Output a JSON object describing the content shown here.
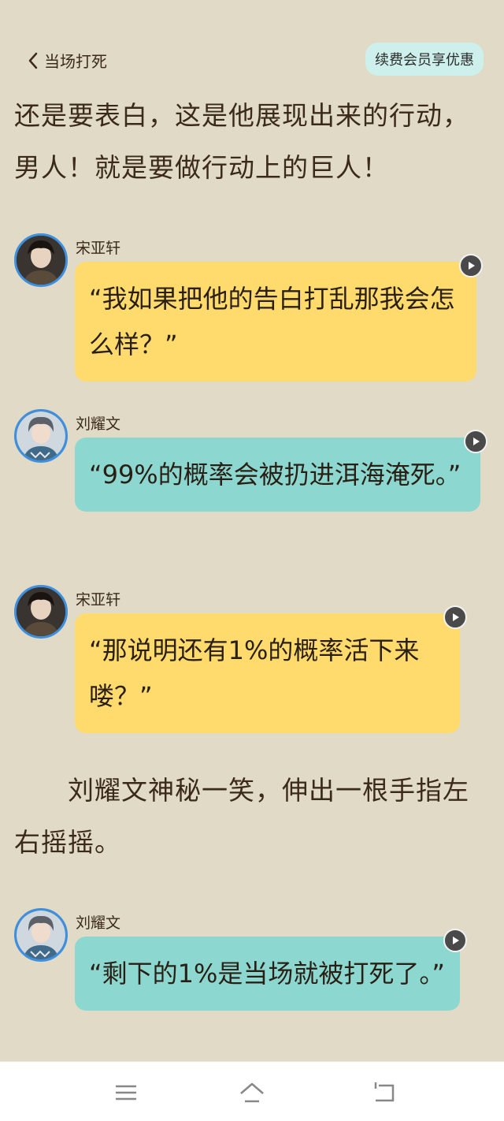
{
  "header": {
    "back_label": "当场打死",
    "vip_label": "续费会员享优惠"
  },
  "narration": {
    "para1": "还是要表白，这是他展现出来的行动，男人！就是要做行动上的巨人！",
    "para2": "　　刘耀文神秘一笑，伸出一根手指左右摇摇。"
  },
  "messages": [
    {
      "speaker": "宋亚轩",
      "text": "“我如果把他的告白打乱那我会怎么样？”",
      "color": "yellow"
    },
    {
      "speaker": "刘耀文",
      "text": "“99%的概率会被扔进洱海淹死。”",
      "color": "teal"
    },
    {
      "speaker": "宋亚轩",
      "text": "“那说明还有1%的概率活下来喽？”",
      "color": "yellow"
    },
    {
      "speaker": "刘耀文",
      "text": "“剩下的1%是当场就被打死了。”",
      "color": "teal"
    }
  ],
  "icons": {
    "back": "chevron-left-icon",
    "play": "play-icon",
    "nav_menu": "menu-icon",
    "nav_home": "home-icon",
    "nav_back": "back-icon"
  },
  "colors": {
    "background": "#E1DAC6",
    "bubble_yellow": "#FFDB6E",
    "bubble_teal": "#8CD8D0",
    "vip_bg": "#CDF0EC",
    "avatar_border": "#3D8FE0"
  }
}
